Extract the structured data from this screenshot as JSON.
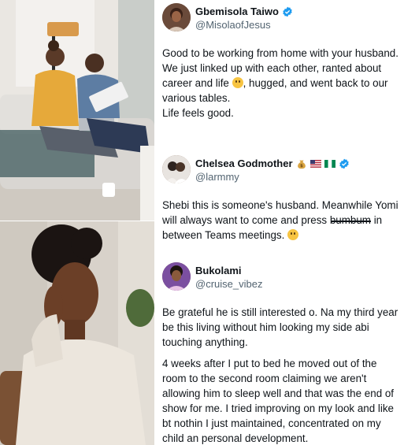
{
  "photos": {
    "top_icon": "couple-working-photo",
    "bottom_icon": "thoughtful-woman-photo"
  },
  "tweets": [
    {
      "name": "Gbemisola Taiwo",
      "handle": "@MisolaofJesus",
      "verified": true,
      "avatar_icon": "woman-avatar",
      "lines": [
        "Good to be working from home with your husband.",
        "We just linked up with each other, ranted about career and life",
        ", hugged, and went back to our various tables.",
        "Life feels good."
      ]
    },
    {
      "name": "Chelsea Godmother",
      "handle": "@larmmy",
      "verified": true,
      "name_emojis": [
        "money-bag-icon",
        "us-flag-icon",
        "nigeria-flag-icon"
      ],
      "avatar_icon": "couple-avatar",
      "text_before": "Shebi this is someone's husband. Meanwhile Yomi will always want to come and press ",
      "struck_word": "bumbum",
      "text_after": " in between Teams meetings.",
      "trailing_emoji": "sweat-smile-emoji"
    },
    {
      "name": "Bukolami",
      "handle": "@cruise_vibez",
      "verified": false,
      "avatar_icon": "woman-avatar",
      "paragraphs": [
        "Be grateful he is still interested o. Na my third year be this living without him looking my side abi touching anything.",
        "4 weeks after I put to bed he moved out of the room to the second room claiming we aren't allowing him to sleep well and that was the end of show for me. I tried improving on my look and like bt nothin I just maintained, concentrated on my child an personal development."
      ]
    }
  ],
  "colors": {
    "verified": "#1d9bf0",
    "text": "#0f1419",
    "handle": "#536471"
  }
}
